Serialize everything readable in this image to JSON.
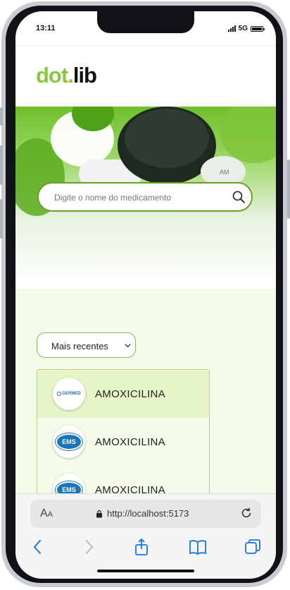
{
  "status_bar": {
    "time": "13:11",
    "network": "5G"
  },
  "header": {
    "logo_part1": "dot.",
    "logo_part2": "lib"
  },
  "search": {
    "placeholder": "Digite o nome do medicamento"
  },
  "filter": {
    "selected": "Mais recentes"
  },
  "results": [
    {
      "name": "AMOXICILINA",
      "brand": "GERMED",
      "highlighted": true
    },
    {
      "name": "AMOXICILINA",
      "brand": "EMS",
      "highlighted": false
    },
    {
      "name": "AMOXICILINA",
      "brand": "EMS",
      "highlighted": false
    }
  ],
  "browser": {
    "aa": "A",
    "aa_small": "A",
    "url": "http://localhost:5173"
  },
  "colors": {
    "brand_green": "#8cc63f",
    "highlight_row": "#e6f5c8",
    "row_bg": "#f4fbe8",
    "ems_blue": "#1b75bb"
  },
  "icons": [
    "search-icon",
    "chevron-down-icon",
    "lock-icon",
    "reload-icon",
    "back-icon",
    "forward-icon",
    "share-icon",
    "bookmarks-icon",
    "tabs-icon"
  ]
}
